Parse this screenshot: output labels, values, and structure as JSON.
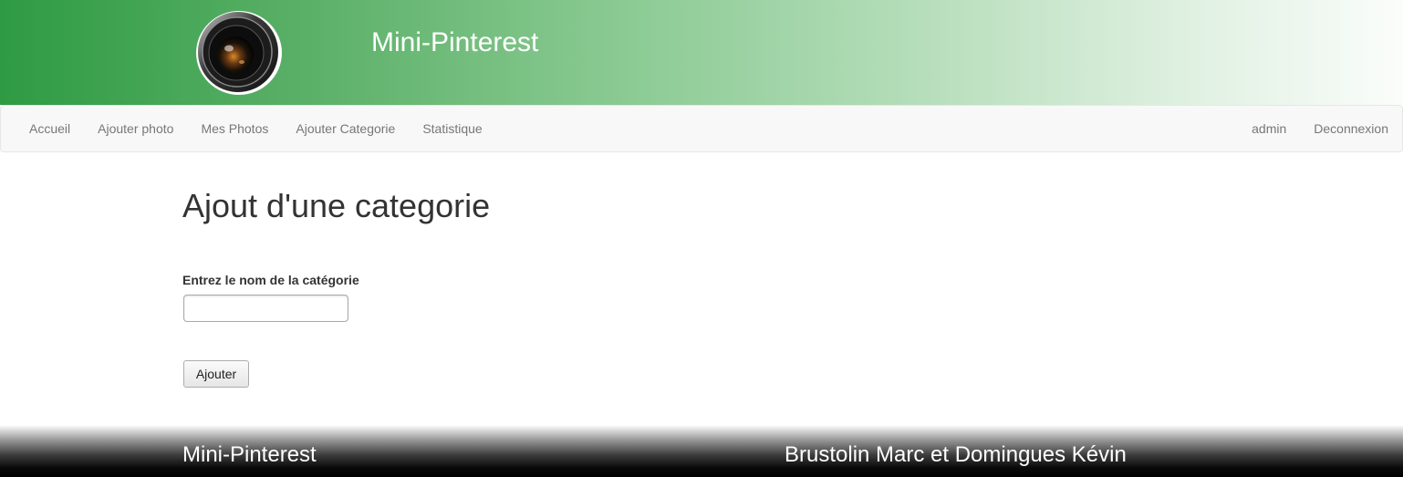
{
  "header": {
    "title": "Mini-Pinterest",
    "logo_icon": "camera-lens-icon"
  },
  "navbar": {
    "left_items": [
      {
        "label": "Accueil"
      },
      {
        "label": "Ajouter photo"
      },
      {
        "label": "Mes Photos"
      },
      {
        "label": "Ajouter Categorie"
      },
      {
        "label": "Statistique"
      }
    ],
    "right_items": [
      {
        "label": "admin"
      },
      {
        "label": "Deconnexion"
      }
    ]
  },
  "main": {
    "title": "Ajout d'une categorie",
    "field_label": "Entrez le nom de la catégorie",
    "input_value": "",
    "submit_label": "Ajouter"
  },
  "footer": {
    "left_text": "Mini-Pinterest",
    "right_text": "Brustolin Marc et Domingues Kévin"
  },
  "colors": {
    "header_gradient_start": "#2e9b43",
    "header_gradient_end": "#fbfdfb",
    "nav_background": "#f8f8f8",
    "nav_text": "#777777",
    "footer_background": "#000000"
  }
}
